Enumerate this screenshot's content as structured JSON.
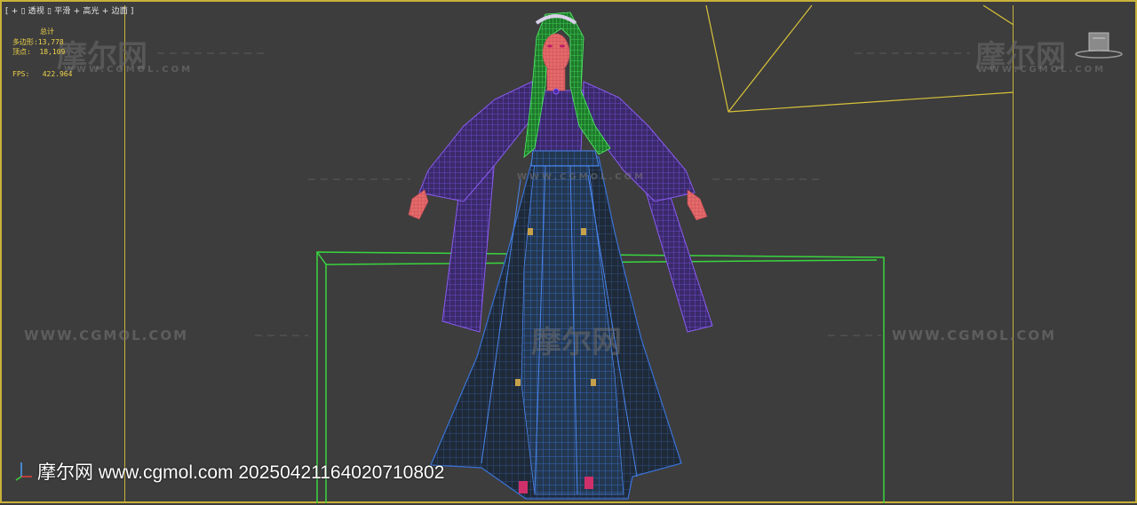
{
  "viewport": {
    "menu": [
      "[",
      "+",
      "▯",
      "透视",
      "▯",
      "平滑",
      "+",
      "高光",
      "+",
      "边面",
      "]"
    ],
    "stats": {
      "header": "总计",
      "polygons_label": "多边形:",
      "polygons_value": "13,778",
      "vertices_label": "顶点:",
      "vertices_value": "18,109",
      "fps_label": "FPS:",
      "fps_value": "422.964"
    }
  },
  "watermarks": {
    "logo_text": "摩尔网",
    "url_caps": "WWW.CGMOL.COM",
    "small_caps": "WWW.CGMOL.COM"
  },
  "footer": {
    "text": "摩尔网 www.cgmol.com 20250421164020710802"
  },
  "colors": {
    "frame": "#c9b23a",
    "camera_lines": "#d8c23a",
    "bbox_green": "#39d63f",
    "wire_purple": "#6a3fc2",
    "wire_blue": "#2f5fb8",
    "hair_green": "#33c24a",
    "skin": "#e86a6a",
    "stats_text": "#f0d44a"
  },
  "icons": [
    "axis-gizmo-icon",
    "viewcube-icon"
  ]
}
